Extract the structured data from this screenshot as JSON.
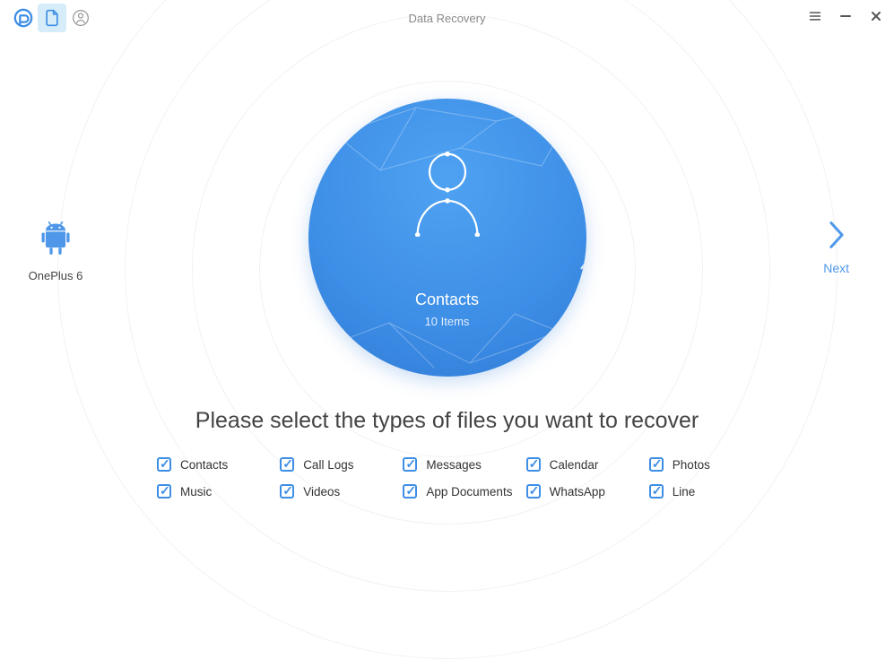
{
  "title": "Data Recovery",
  "device": {
    "name": "OnePlus 6"
  },
  "next": {
    "label": "Next"
  },
  "carousel": {
    "current": {
      "name": "Contacts",
      "count_label": "10 Items"
    }
  },
  "prompt": "Please select the types of files you want to recover",
  "filetypes": [
    {
      "label": "Contacts",
      "checked": true
    },
    {
      "label": "Call Logs",
      "checked": true
    },
    {
      "label": "Messages",
      "checked": true
    },
    {
      "label": "Calendar",
      "checked": true
    },
    {
      "label": "Photos",
      "checked": true
    },
    {
      "label": "Music",
      "checked": true
    },
    {
      "label": "Videos",
      "checked": true
    },
    {
      "label": "App Documents",
      "checked": true
    },
    {
      "label": "WhatsApp",
      "checked": true
    },
    {
      "label": "Line",
      "checked": true
    }
  ],
  "colors": {
    "accent": "#3d8ee6"
  }
}
